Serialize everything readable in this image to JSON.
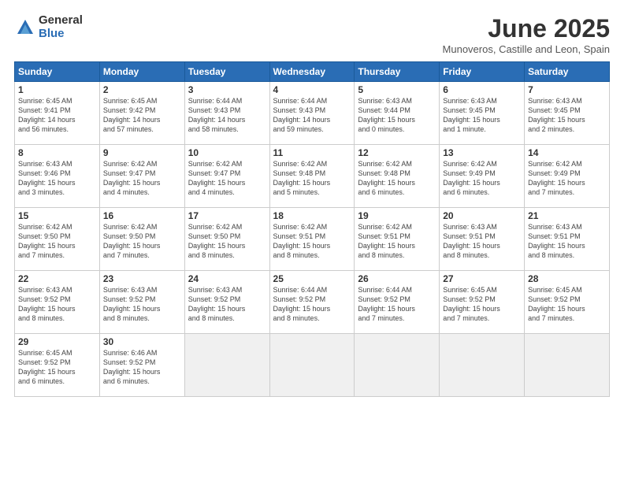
{
  "logo": {
    "general": "General",
    "blue": "Blue"
  },
  "title": "June 2025",
  "subtitle": "Munoveros, Castille and Leon, Spain",
  "headers": [
    "Sunday",
    "Monday",
    "Tuesday",
    "Wednesday",
    "Thursday",
    "Friday",
    "Saturday"
  ],
  "days": [
    {
      "num": "",
      "info": ""
    },
    {
      "num": "",
      "info": ""
    },
    {
      "num": "",
      "info": ""
    },
    {
      "num": "",
      "info": ""
    },
    {
      "num": "",
      "info": ""
    },
    {
      "num": "",
      "info": ""
    },
    {
      "num": "1",
      "info": "Sunrise: 6:45 AM\nSunset: 9:41 PM\nDaylight: 14 hours\nand 56 minutes."
    },
    {
      "num": "2",
      "info": "Sunrise: 6:45 AM\nSunset: 9:42 PM\nDaylight: 14 hours\nand 57 minutes."
    },
    {
      "num": "3",
      "info": "Sunrise: 6:44 AM\nSunset: 9:43 PM\nDaylight: 14 hours\nand 58 minutes."
    },
    {
      "num": "4",
      "info": "Sunrise: 6:44 AM\nSunset: 9:43 PM\nDaylight: 14 hours\nand 59 minutes."
    },
    {
      "num": "5",
      "info": "Sunrise: 6:43 AM\nSunset: 9:44 PM\nDaylight: 15 hours\nand 0 minutes."
    },
    {
      "num": "6",
      "info": "Sunrise: 6:43 AM\nSunset: 9:45 PM\nDaylight: 15 hours\nand 1 minute."
    },
    {
      "num": "7",
      "info": "Sunrise: 6:43 AM\nSunset: 9:45 PM\nDaylight: 15 hours\nand 2 minutes."
    },
    {
      "num": "8",
      "info": "Sunrise: 6:43 AM\nSunset: 9:46 PM\nDaylight: 15 hours\nand 3 minutes."
    },
    {
      "num": "9",
      "info": "Sunrise: 6:42 AM\nSunset: 9:47 PM\nDaylight: 15 hours\nand 4 minutes."
    },
    {
      "num": "10",
      "info": "Sunrise: 6:42 AM\nSunset: 9:47 PM\nDaylight: 15 hours\nand 4 minutes."
    },
    {
      "num": "11",
      "info": "Sunrise: 6:42 AM\nSunset: 9:48 PM\nDaylight: 15 hours\nand 5 minutes."
    },
    {
      "num": "12",
      "info": "Sunrise: 6:42 AM\nSunset: 9:48 PM\nDaylight: 15 hours\nand 6 minutes."
    },
    {
      "num": "13",
      "info": "Sunrise: 6:42 AM\nSunset: 9:49 PM\nDaylight: 15 hours\nand 6 minutes."
    },
    {
      "num": "14",
      "info": "Sunrise: 6:42 AM\nSunset: 9:49 PM\nDaylight: 15 hours\nand 7 minutes."
    },
    {
      "num": "15",
      "info": "Sunrise: 6:42 AM\nSunset: 9:50 PM\nDaylight: 15 hours\nand 7 minutes."
    },
    {
      "num": "16",
      "info": "Sunrise: 6:42 AM\nSunset: 9:50 PM\nDaylight: 15 hours\nand 7 minutes."
    },
    {
      "num": "17",
      "info": "Sunrise: 6:42 AM\nSunset: 9:50 PM\nDaylight: 15 hours\nand 8 minutes."
    },
    {
      "num": "18",
      "info": "Sunrise: 6:42 AM\nSunset: 9:51 PM\nDaylight: 15 hours\nand 8 minutes."
    },
    {
      "num": "19",
      "info": "Sunrise: 6:42 AM\nSunset: 9:51 PM\nDaylight: 15 hours\nand 8 minutes."
    },
    {
      "num": "20",
      "info": "Sunrise: 6:43 AM\nSunset: 9:51 PM\nDaylight: 15 hours\nand 8 minutes."
    },
    {
      "num": "21",
      "info": "Sunrise: 6:43 AM\nSunset: 9:51 PM\nDaylight: 15 hours\nand 8 minutes."
    },
    {
      "num": "22",
      "info": "Sunrise: 6:43 AM\nSunset: 9:52 PM\nDaylight: 15 hours\nand 8 minutes."
    },
    {
      "num": "23",
      "info": "Sunrise: 6:43 AM\nSunset: 9:52 PM\nDaylight: 15 hours\nand 8 minutes."
    },
    {
      "num": "24",
      "info": "Sunrise: 6:43 AM\nSunset: 9:52 PM\nDaylight: 15 hours\nand 8 minutes."
    },
    {
      "num": "25",
      "info": "Sunrise: 6:44 AM\nSunset: 9:52 PM\nDaylight: 15 hours\nand 8 minutes."
    },
    {
      "num": "26",
      "info": "Sunrise: 6:44 AM\nSunset: 9:52 PM\nDaylight: 15 hours\nand 7 minutes."
    },
    {
      "num": "27",
      "info": "Sunrise: 6:45 AM\nSunset: 9:52 PM\nDaylight: 15 hours\nand 7 minutes."
    },
    {
      "num": "28",
      "info": "Sunrise: 6:45 AM\nSunset: 9:52 PM\nDaylight: 15 hours\nand 7 minutes."
    },
    {
      "num": "29",
      "info": "Sunrise: 6:45 AM\nSunset: 9:52 PM\nDaylight: 15 hours\nand 6 minutes."
    },
    {
      "num": "30",
      "info": "Sunrise: 6:46 AM\nSunset: 9:52 PM\nDaylight: 15 hours\nand 6 minutes."
    },
    {
      "num": "",
      "info": ""
    },
    {
      "num": "",
      "info": ""
    },
    {
      "num": "",
      "info": ""
    },
    {
      "num": "",
      "info": ""
    },
    {
      "num": "",
      "info": ""
    }
  ]
}
